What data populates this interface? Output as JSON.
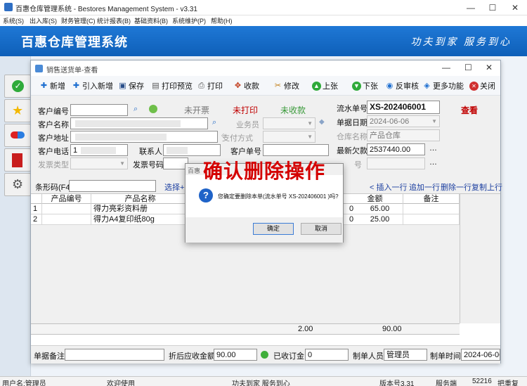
{
  "window": {
    "title": "百惠仓库管理系统 - Bestores Management System - v3.31",
    "minimize": "—",
    "maximize": "☐",
    "close": "✕"
  },
  "menu": [
    "系统(S)",
    "出入库(S)",
    "财务管理(C)",
    "统计报表(B)",
    "基础资料(B)",
    "系统维护(P)",
    "帮助(H)"
  ],
  "banner": {
    "title": "百惠仓库管理系统",
    "slogan": "功夫到家 服务到心"
  },
  "child": {
    "title": "销售送货单-查看",
    "toolbar": [
      "新增",
      "引入新增",
      "保存",
      "打印预览",
      "打印",
      "收款",
      "修改",
      "上张",
      "下张",
      "反审核",
      "更多功能",
      "关闭"
    ],
    "form": {
      "customer_code_label": "客户编号",
      "customer_name_label": "客户名称",
      "customer_addr_label": "客户地址",
      "customer_phone_label": "客户电话",
      "customer_phone_value": "1",
      "contact_label": "联系人",
      "invoice_type_label": "发票类型",
      "invoice_no_label": "发票号码",
      "status_not_invoiced": "未开票",
      "status_not_printed": "未打印",
      "status_not_collected": "未收款",
      "salesman_label": "业务员",
      "payment_method_label": "支付方式",
      "customer_order_label": "客户单号",
      "serial_label": "流水单号",
      "serial_value": "XS-202406001",
      "date_label": "单据日期",
      "date_value": "2024-06-06",
      "warehouse_label": "仓库名称",
      "warehouse_value": "产品仓库",
      "balance_label": "最新欠款",
      "balance_value": "2537440.00",
      "extra_label": "号",
      "view_mode": "查看"
    },
    "barcode": {
      "label": "条形码(F4)",
      "select_link": "选择++"
    },
    "row_actions": [
      "插入一行",
      "追加一行",
      "删除一行",
      "复制上行"
    ],
    "grid": {
      "columns": [
        "产品编号",
        "产品名称",
        "金额",
        "备注"
      ],
      "rows": [
        {
          "idx": "1",
          "name": "得力亮彩资料册",
          "qty_tail": "0",
          "amount": "65.00"
        },
        {
          "idx": "2",
          "name": "得力A4复印纸80g",
          "qty_tail": "0",
          "amount": "25.00"
        }
      ],
      "total_qty": "2.00",
      "total_amount": "90.00"
    },
    "footer": {
      "remark_label": "单据备注",
      "discount_label": "折后应收金额",
      "discount_value": "90.00",
      "deposit_label": "已收订金",
      "deposit_value": "0",
      "creator_label": "制单人员",
      "creator_value": "管理员",
      "made_time_label": "制单时间",
      "made_time_value": "2024-06-06"
    }
  },
  "dialog": {
    "title": "百惠",
    "message": "您确定要删除本单(流水单号 XS-202406001 )吗?",
    "confirm": "确定",
    "cancel": "取消"
  },
  "annotation": "确认删除操作",
  "statusbar": {
    "user": "用户名:管理员",
    "welcome": "欢迎使用",
    "slogan": "功夫到家 服务到心",
    "version": "版本号3.31",
    "mode": "服务端",
    "port": "52216",
    "reload": "把重复"
  },
  "colors": {
    "banner": "#1565c0",
    "annotation": "#d40000",
    "view_mode": "#c00000",
    "status_green": "#3a9a3a",
    "status_red": "#c00000"
  }
}
